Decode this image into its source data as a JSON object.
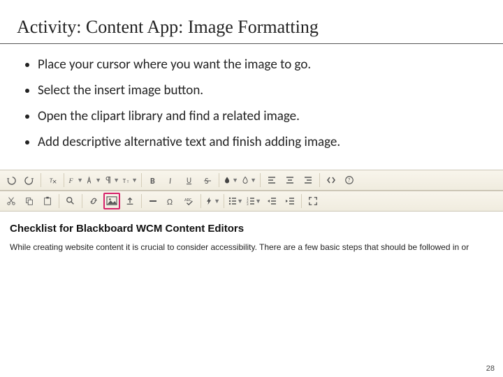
{
  "title": "Activity: Content App: Image Formatting",
  "bullets": [
    "Place your cursor where you want the image to go.",
    "Select the insert image button.",
    "Open the clipart library and find a related image.",
    "Add descriptive alternative text and finish adding image."
  ],
  "toolbar": {
    "row1": [
      "undo",
      "redo",
      "clear-format",
      "font-family",
      "font-size",
      "paragraph",
      "text-size",
      "bold",
      "italic",
      "underline",
      "strike",
      "text-color",
      "back-color",
      "align-left",
      "align-center",
      "align-right",
      "code",
      "help"
    ],
    "row2": [
      "cut",
      "copy",
      "paste",
      "find",
      "link",
      "insert-image",
      "upload",
      "emdash",
      "omega",
      "spellcheck",
      "flash",
      "bullet-list",
      "number-list",
      "indent",
      "outdent",
      "fullscreen"
    ]
  },
  "doc": {
    "heading": "Checklist for Blackboard WCM Content Editors",
    "paragraph": "While creating website content it is crucial to consider accessibility. There are a few basic steps that should be followed in or"
  },
  "page_number": "28"
}
